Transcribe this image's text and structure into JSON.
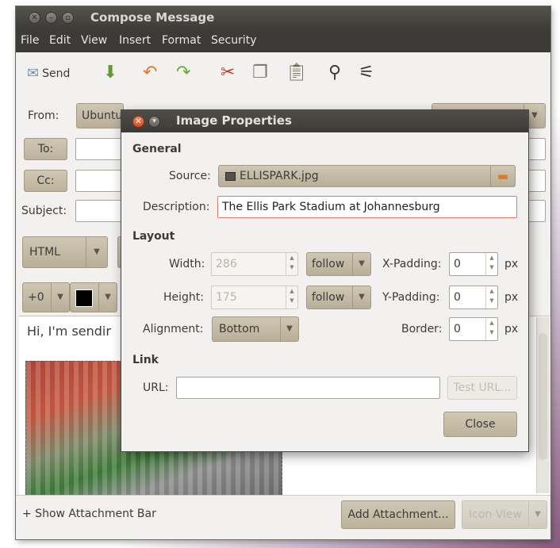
{
  "window": {
    "title": "Compose Message",
    "menus": [
      "File",
      "Edit",
      "View",
      "Insert",
      "Format",
      "Security"
    ]
  },
  "toolbar": {
    "send_label": "Send"
  },
  "header": {
    "from_label": "From:",
    "from_value": "Ubuntu",
    "to_label": "To:",
    "cc_label": "Cc:",
    "subject_label": "Subject:"
  },
  "format": {
    "mode": "HTML",
    "size": "+0",
    "text_color": "#000000"
  },
  "editor": {
    "body_text": "Hi, I'm sendir"
  },
  "status": {
    "show_attachment_bar": "+  Show Attachment Bar",
    "add_attachment": "Add Attachment...",
    "icon_view": "Icon View"
  },
  "dialog": {
    "title": "Image Properties",
    "general_heading": "General",
    "source_label": "Source:",
    "source_value": "ELLISPARK.jpg",
    "description_label": "Description:",
    "description_value": "The Ellis Park Stadium at Johannesburg",
    "layout_heading": "Layout",
    "width_label": "Width:",
    "width_value": "286",
    "height_label": "Height:",
    "height_value": "175",
    "width_mode": "follow",
    "height_mode": "follow",
    "xpad_label": "X-Padding:",
    "xpad_value": "0",
    "ypad_label": "Y-Padding:",
    "ypad_value": "0",
    "border_label": "Border:",
    "border_value": "0",
    "unit": "px",
    "alignment_label": "Alignment:",
    "alignment_value": "Bottom",
    "link_heading": "Link",
    "url_label": "URL:",
    "url_value": "",
    "test_url": "Test URL...",
    "close": "Close"
  }
}
